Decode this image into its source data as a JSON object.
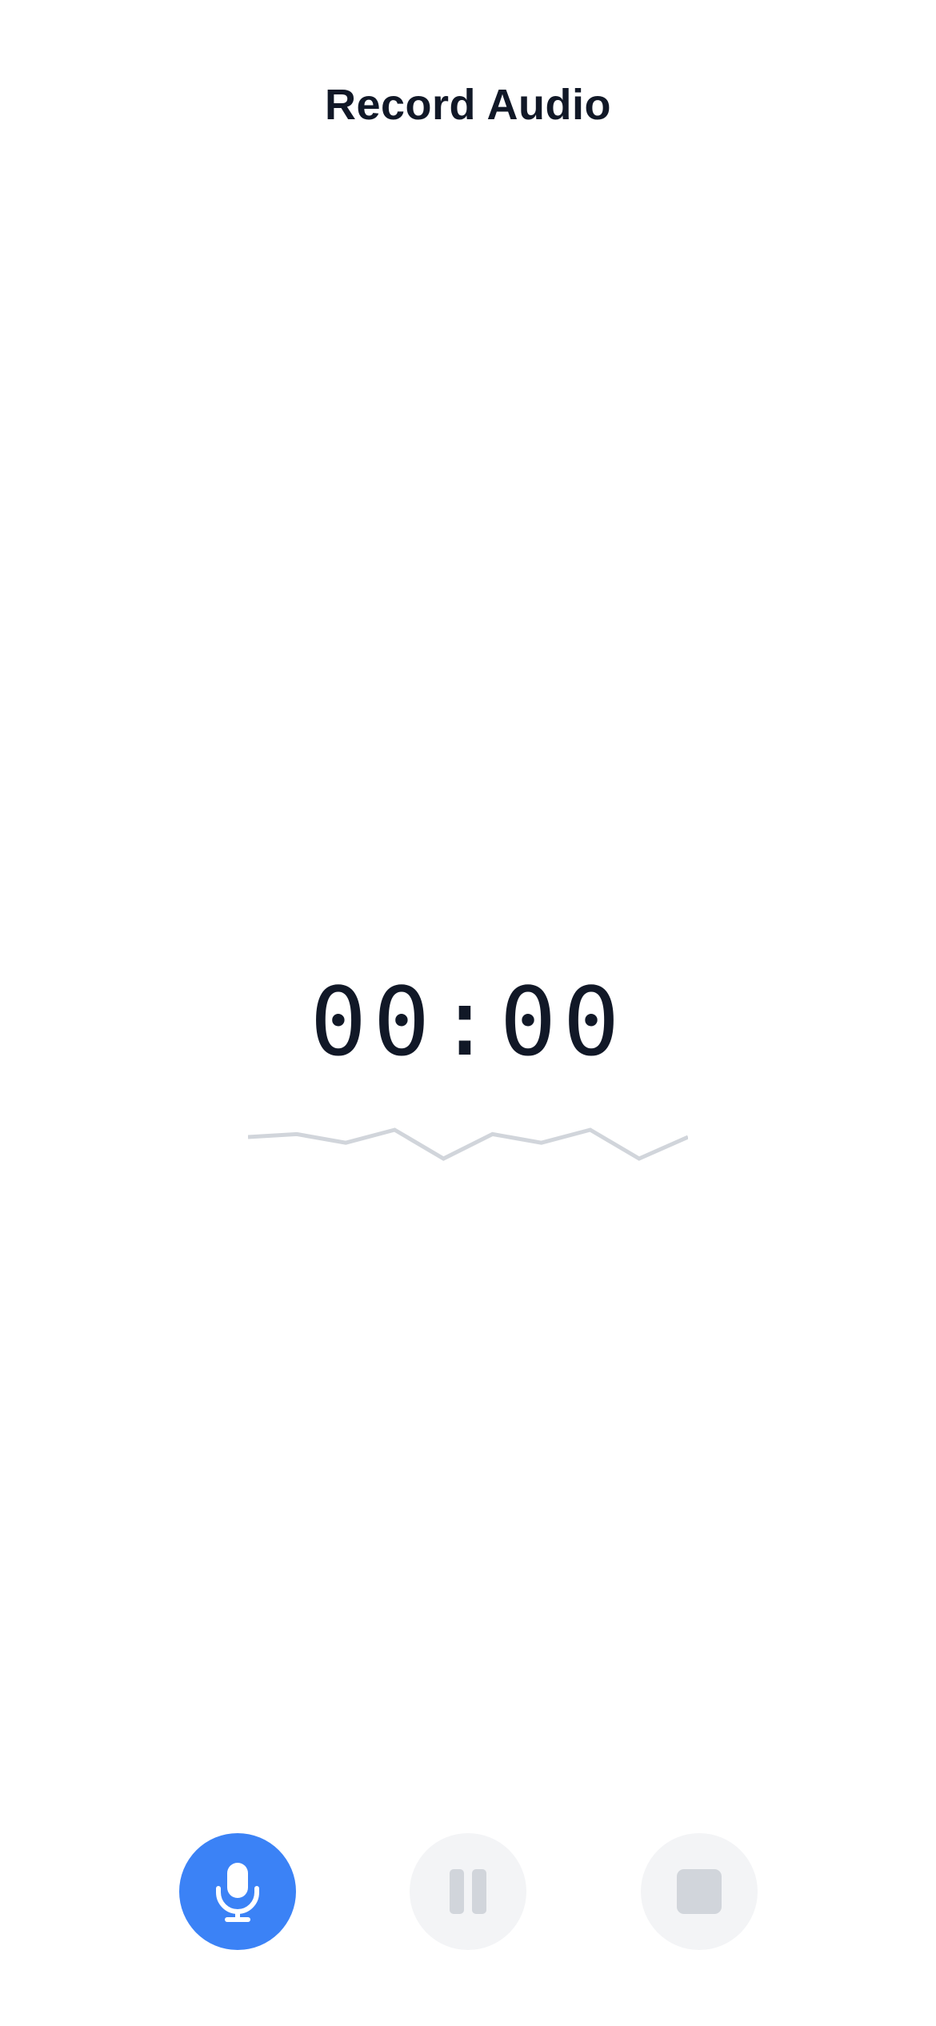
{
  "header": {
    "title": "Record Audio"
  },
  "recorder": {
    "elapsed": "00:00",
    "waveform": [
      0.25,
      0.15,
      0.45,
      0.0,
      1.0,
      0.15,
      0.45,
      0.0,
      1.0,
      0.25
    ]
  },
  "controls": {
    "record": {
      "icon": "microphone-icon",
      "enabled": true
    },
    "pause": {
      "icon": "pause-icon",
      "enabled": false
    },
    "stop": {
      "icon": "stop-icon",
      "enabled": false
    }
  },
  "colors": {
    "accent": "#3b82f6",
    "disabled_bg": "#f3f4f6",
    "disabled_icon": "#d1d5db",
    "text": "#111827",
    "waveform": "#d1d5db"
  }
}
